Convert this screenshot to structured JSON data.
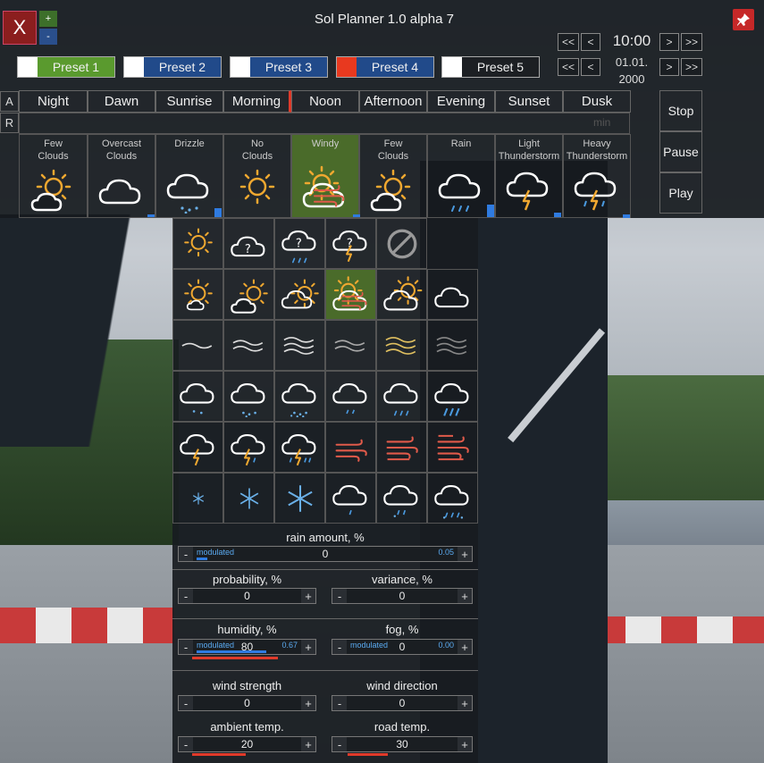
{
  "app": {
    "title": "Sol Planner 1.0 alpha 7",
    "close_label": "X",
    "plus_label": "+",
    "minus_label": "-"
  },
  "presets": [
    {
      "label": "Preset 1",
      "color": "#5a9a2e",
      "swatch": "#ffffff"
    },
    {
      "label": "Preset 2",
      "color": "#214a8a",
      "swatch": "#ffffff"
    },
    {
      "label": "Preset 3",
      "color": "#214a8a",
      "swatch": "#ffffff"
    },
    {
      "label": "Preset 4",
      "color": "#214a8a",
      "swatch": "#e8391f"
    },
    {
      "label": "Preset 5",
      "color": "#1c1f23",
      "swatch": "#ffffff"
    }
  ],
  "time": {
    "clock": "10:00",
    "date_line1": "01.01.",
    "date_line2": "2000",
    "rewind": "<<",
    "back": "<",
    "forward": ">",
    "fast": ">>"
  },
  "rows": {
    "a_label": "A",
    "r_label": "R",
    "min_hint": "min"
  },
  "phases": [
    "Night",
    "Dawn",
    "Sunrise",
    "Morning",
    "Noon",
    "Afternoon",
    "Evening",
    "Sunset",
    "Dusk"
  ],
  "weather_cards": [
    {
      "line1": "Few",
      "line2": "Clouds",
      "icon": "sun-cloud-icon"
    },
    {
      "line1": "Overcast",
      "line2": "Clouds",
      "icon": "cloud-icon"
    },
    {
      "line1": "Drizzle",
      "line2": "",
      "icon": "drizzle-icon"
    },
    {
      "line1": "No",
      "line2": "Clouds",
      "icon": "sun-icon"
    },
    {
      "line1": "Windy",
      "line2": "",
      "icon": "windy-icon"
    },
    {
      "line1": "Few",
      "line2": "Clouds",
      "icon": "sun-cloud-icon"
    },
    {
      "line1": "Rain",
      "line2": "",
      "icon": "rain-icon"
    },
    {
      "line1": "Light",
      "line2": "Thunderstorm",
      "icon": "thunder-icon"
    },
    {
      "line1": "Heavy",
      "line2": "Thunderstorm",
      "icon": "heavy-thunder-icon"
    }
  ],
  "controls": {
    "stop": "Stop",
    "pause": "Pause",
    "play": "Play"
  },
  "params": {
    "rain": {
      "label": "rain amount, %",
      "value": "0",
      "mod": "modulated",
      "mod_value": "0.05"
    },
    "probability": {
      "label": "probability, %",
      "value": "0"
    },
    "variance": {
      "label": "variance, %",
      "value": "0"
    },
    "humidity": {
      "label": "humidity, %",
      "value": "80",
      "mod": "modulated",
      "mod_value": "0.67"
    },
    "fog": {
      "label": "fog, %",
      "value": "0",
      "mod": "modulated",
      "mod_value": "0.00"
    },
    "wind_strength": {
      "label": "wind strength",
      "value": "0"
    },
    "wind_direction": {
      "label": "wind direction",
      "value": "0"
    },
    "ambient": {
      "label": "ambient temp.",
      "value": "20"
    },
    "road": {
      "label": "road temp.",
      "value": "30"
    }
  },
  "buttons": {
    "minus": "-",
    "plus": "+"
  }
}
